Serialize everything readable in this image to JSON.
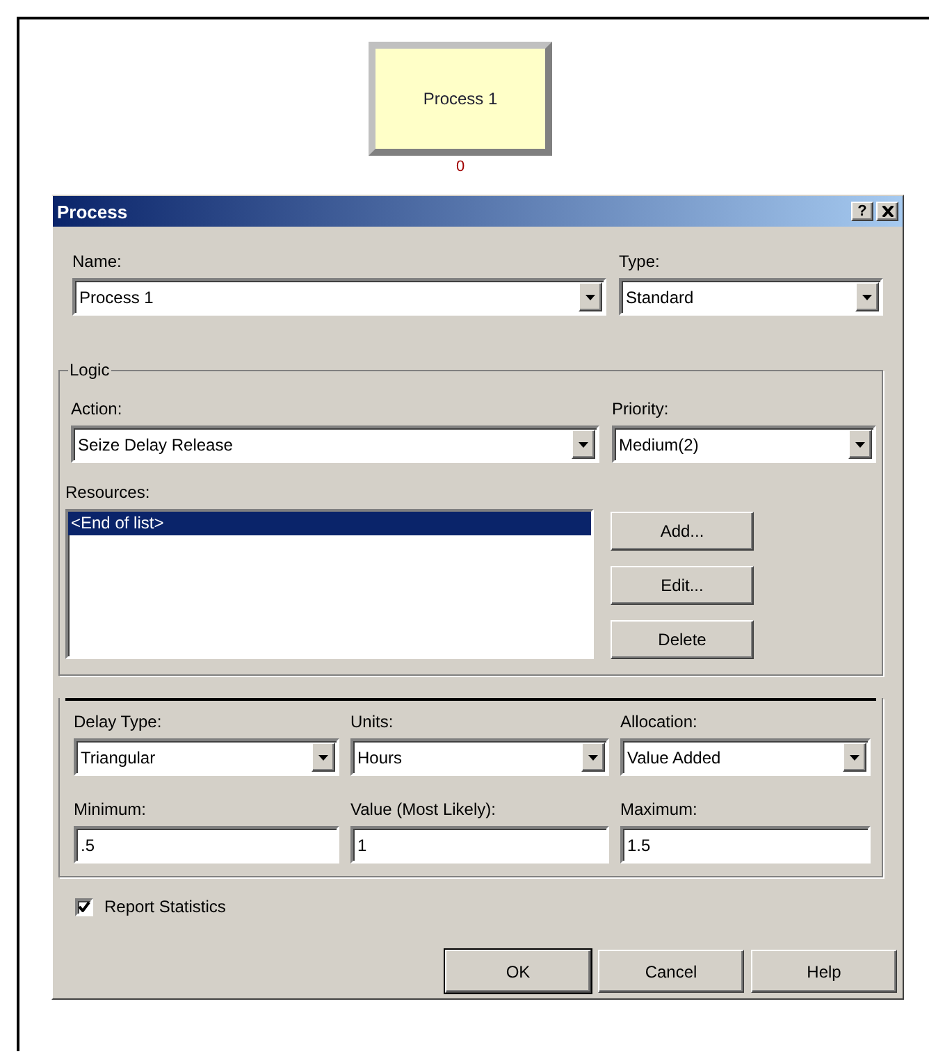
{
  "canvas": {
    "module": {
      "label": "Process 1",
      "count": "0"
    }
  },
  "dialog": {
    "title": "Process",
    "help_button": "?",
    "top_fields": [
      {
        "kind": "combo",
        "label": "Name:",
        "value": "Process 1"
      },
      {
        "kind": "combo",
        "label": "Type:",
        "value": "Standard"
      }
    ],
    "logic": {
      "legend": "Logic",
      "fields": [
        {
          "kind": "combo",
          "label": "Action:",
          "value": "Seize Delay Release"
        },
        {
          "kind": "combo",
          "label": "Priority:",
          "value": "Medium(2)"
        }
      ],
      "resources": {
        "label": "Resources:",
        "items": [
          {
            "text": "<End of list>",
            "selected": true
          }
        ]
      },
      "buttons": [
        "Add...",
        "Edit...",
        "Delete"
      ]
    },
    "delay_fields": [
      {
        "kind": "combo",
        "label": "Delay Type:",
        "value": "Triangular"
      },
      {
        "kind": "combo",
        "label": "Units:",
        "value": "Hours"
      },
      {
        "kind": "combo",
        "label": "Allocation:",
        "value": "Value Added"
      },
      {
        "kind": "text",
        "label": "Minimum:",
        "value": ".5"
      },
      {
        "kind": "text",
        "label": "Value (Most Likely):",
        "value": "1"
      },
      {
        "kind": "text",
        "label": "Maximum:",
        "value": "1.5"
      }
    ],
    "report_statistics": {
      "label": "Report Statistics",
      "checked": true
    },
    "buttons": [
      {
        "label": "OK",
        "default": true
      },
      {
        "label": "Cancel",
        "default": false
      },
      {
        "label": "Help",
        "default": false
      }
    ]
  }
}
